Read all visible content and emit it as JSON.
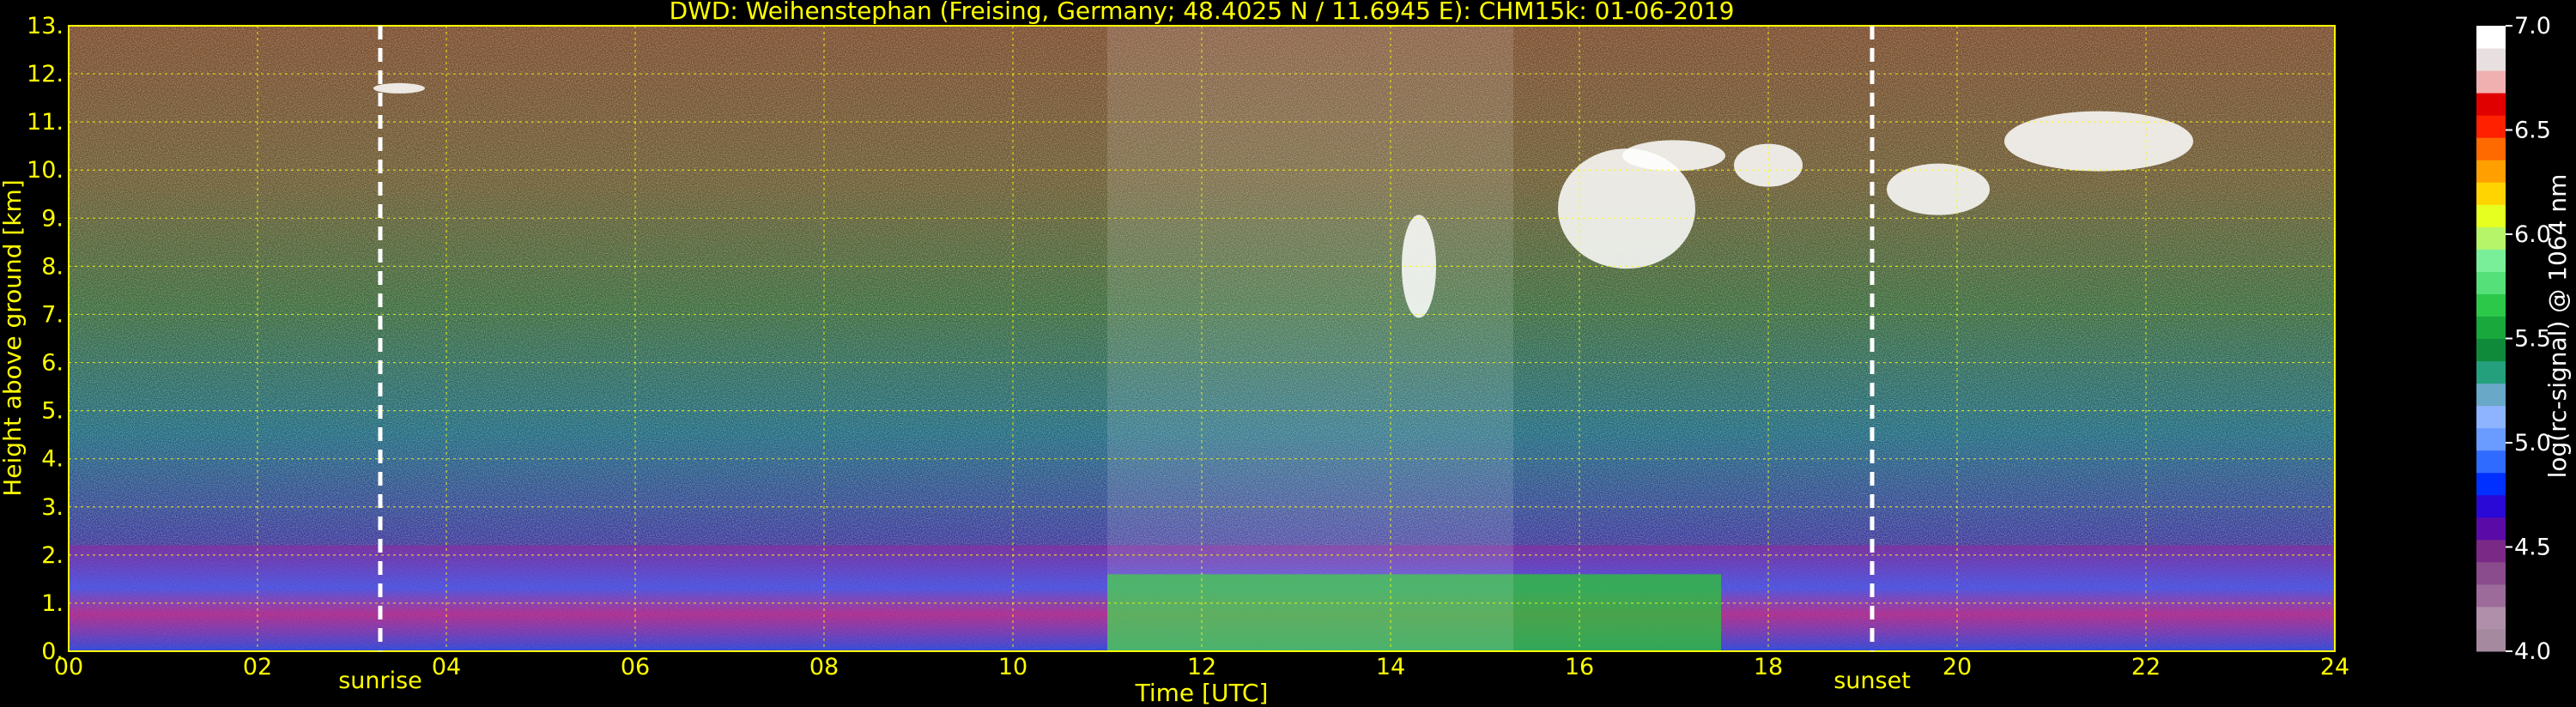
{
  "chart_data": {
    "type": "heatmap",
    "title": "DWD: Weihenstephan (Freising, Germany; 48.4025 N / 11.6945 E):    CHM15k: 01-06-2019",
    "xlabel": "Time [UTC]",
    "ylabel": "Height above ground [km]",
    "xlim": [
      0,
      24
    ],
    "ylim": [
      0,
      13
    ],
    "x_ticks": [
      "00",
      "02",
      "04",
      "06",
      "08",
      "10",
      "12",
      "14",
      "16",
      "18",
      "20",
      "22",
      "24"
    ],
    "y_ticks": [
      "0.",
      "1.",
      "2.",
      "3.",
      "4.",
      "5.",
      "6.",
      "7.",
      "8.",
      "9.",
      "10.",
      "11.",
      "12.",
      "13."
    ],
    "grid": true,
    "colorbar": {
      "label": "log(rc-signal) @ 1064 nm",
      "range": [
        4.0,
        7.0
      ],
      "ticks": [
        "4.0",
        "4.5",
        "5.0",
        "5.5",
        "6.0",
        "6.5",
        "7.0"
      ],
      "colors": [
        "#a58a9f",
        "#b08fab",
        "#9c6b9a",
        "#8a4c8c",
        "#7a2a86",
        "#5a0aa6",
        "#2a08d6",
        "#0030ff",
        "#2f6bff",
        "#6a9bff",
        "#8fb4ff",
        "#6aa8c8",
        "#24a07c",
        "#0f8a3a",
        "#18a83c",
        "#2cc84a",
        "#55e07a",
        "#7aef9a",
        "#b6f56a",
        "#e6ff20",
        "#ffd400",
        "#ffa000",
        "#ff6a00",
        "#ff2000",
        "#e00000",
        "#f0b0b0",
        "#e8e0e0",
        "#ffffff"
      ]
    },
    "markers": [
      {
        "label": "sunrise",
        "time": 3.3
      },
      {
        "label": "sunset",
        "time": 19.1
      }
    ]
  }
}
